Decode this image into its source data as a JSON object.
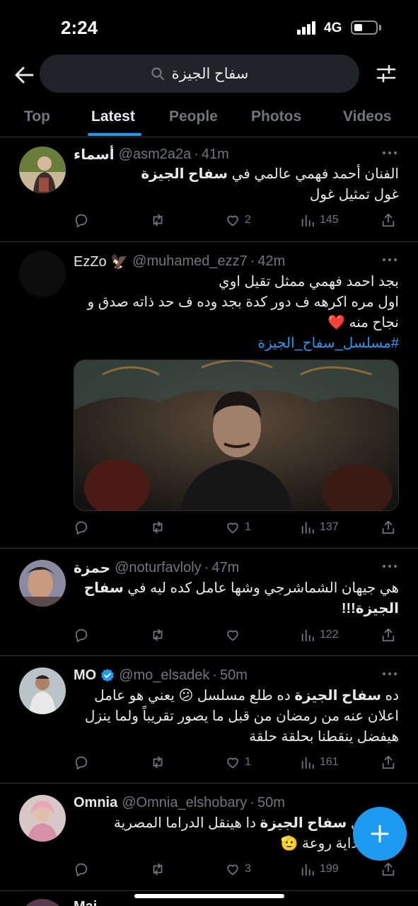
{
  "status_bar": {
    "time": "2:24",
    "network": "4G"
  },
  "search": {
    "query": "سفاح الجيزة"
  },
  "tabs": [
    "Top",
    "Latest",
    "People",
    "Photos",
    "Videos"
  ],
  "active_tab": "Latest",
  "tweets": [
    {
      "name": "أسماء",
      "handle": "@asm2a2a",
      "time": "41m",
      "lines": [
        [
          "الفنان أحمد فهمي عالمي في ",
          "سفاح الجيزة"
        ],
        [
          "غول تمثيل غول",
          ""
        ]
      ],
      "replies": "",
      "retweets": "",
      "likes": "2",
      "views": "145"
    },
    {
      "name": "EzZo 🦅",
      "handle": "@muhamed_ezz7",
      "time": "42m",
      "lines": [
        "بجد احمد فهمي ممثل تقيل اوي",
        "اول مره اكرهه ف دور كدة بجد وده ف حد ذاته صدق و",
        "نجاح منه ❤️"
      ],
      "hashtag": "#مسلسل_سفاح_الجيزة",
      "likes": "1",
      "views": "137"
    },
    {
      "name": "حمزة",
      "handle": "@noturfavloly",
      "time": "47m",
      "lines": [
        [
          "هي جيهان الشماشرجي وشها عامل كده ليه في ",
          "سفاح"
        ],
        [
          "",
          "الجيزة",
          "!!!"
        ]
      ],
      "likes": "",
      "views": "122"
    },
    {
      "name": "MO",
      "handle": "@mo_elsadek",
      "time": "50m",
      "verified": true,
      "lines": [
        [
          "ده ",
          "سفاح الجيزة",
          " ده طلع مسلسل 😕 يعني هو عامل"
        ],
        "اعلان عنه من رمضان من قبل ما يصور تقريباً ولما ينزل",
        "هيفضل ينقطنا بحلقة حلقة"
      ],
      "likes": "1",
      "views": "161"
    },
    {
      "name": "Omnia",
      "handle": "@Omnia_elshobary",
      "time": "50m",
      "lines": [
        [
          "مسلسل ",
          "سفاح الجيزة",
          " دا هينقل الدراما المصرية"
        ],
        "تانية ، بداية روعة 🫡"
      ],
      "likes": "3",
      "views": "199"
    }
  ],
  "peek_text": "Mai"
}
